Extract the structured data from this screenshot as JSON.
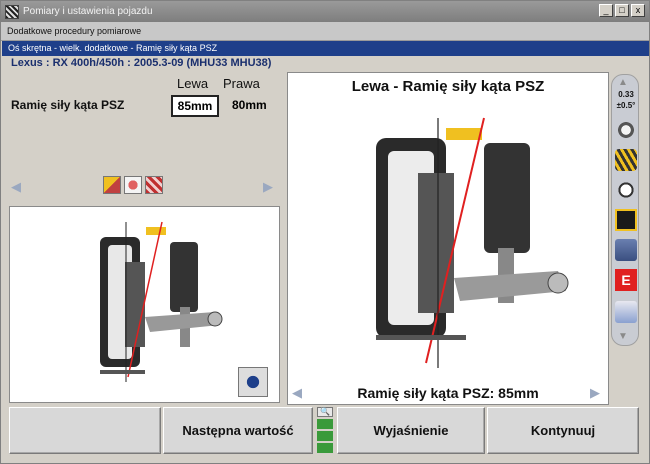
{
  "window": {
    "title": "Pomiary i ustawienia pojazdu",
    "controls": [
      "_",
      "□",
      "x"
    ]
  },
  "subheader": "Dodatkowe procedury pomiarowe",
  "breadcrumb": "Oś skrętna - wielk. dodatkowe  -  Ramię siły kąta PSZ",
  "vehicle": "Lexus : RX 400h/450h : 2005.3-09 (MHU33 MHU38)",
  "measurement": {
    "col_left": "Lewa",
    "col_right": "Prawa",
    "label": "Ramię siły kąta PSZ",
    "left_value": "85mm",
    "right_value": "80mm"
  },
  "main_view": {
    "title": "Lewa - Ramię siły kąta PSZ",
    "caption": "Ramię siły kąta PSZ: 85mm"
  },
  "toolbar": {
    "tolerance_value": "0.33",
    "tolerance_range": "±0.5°",
    "icons": [
      "wrench-adjust-icon",
      "tire-tread-icon",
      "steering-gauge-icon",
      "timer-display-icon",
      "lift-icon",
      "spec-e-icon",
      "printer-icon"
    ]
  },
  "buttons": {
    "blank": "",
    "next": "Następna wartość",
    "explain": "Wyjaśnienie",
    "continue": "Kontynuuj"
  },
  "colors": {
    "breadcrumb_bg": "#1e3f8a",
    "vehicle_text": "#1a2f6e",
    "axis_red": "#e02020",
    "highlight_yellow": "#f0c020"
  }
}
